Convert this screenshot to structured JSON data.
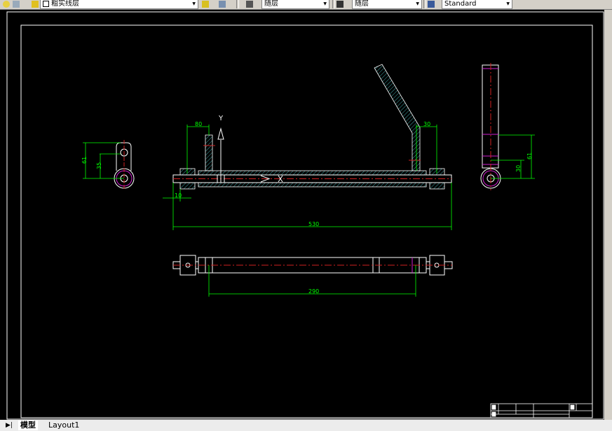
{
  "toolbar": {
    "layer_name": "粗实线层",
    "color_value": "随层",
    "linetype_value": "随层",
    "text_style_value": "Standard"
  },
  "drawing": {
    "dimensions": {
      "front_left_width": "80",
      "front_right_width": "30",
      "front_offset": "10",
      "front_total_length": "530",
      "top_view_length": "290",
      "left_view_height_outer": "61",
      "left_view_height_inner": "35",
      "right_view_height_outer": "61",
      "right_view_height_inner": "30"
    },
    "axis_label": "Y",
    "colors": {
      "background": "#000000",
      "outline": "#ffffff",
      "hatch": "#4fd0d0",
      "dimension": "#00ff00",
      "centerline": "#d02020",
      "hidden": "#d020d0"
    }
  },
  "tabs": [
    {
      "label": "模型",
      "active": true
    },
    {
      "label": "Layout1",
      "active": false
    }
  ]
}
